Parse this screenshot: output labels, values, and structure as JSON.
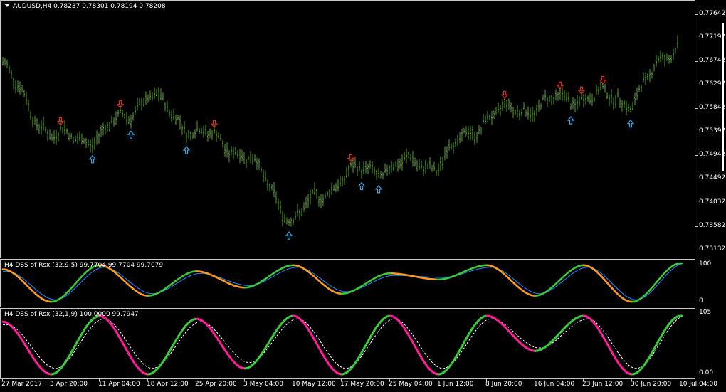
{
  "main_chart": {
    "title": "AUDUSD,H4  0.78237 0.78301 0.78194 0.78208",
    "price_labels": [
      "0.77642",
      "0.77192",
      "0.76742",
      "0.76292",
      "0.75842",
      "0.75392",
      "0.74942",
      "0.74492",
      "0.74032",
      "0.73582",
      "0.73132"
    ],
    "bar_color": "#5aa02c",
    "up_arrow_color": "#3aa6e0",
    "down_arrow_color": "#e0261e"
  },
  "indicator1": {
    "title": "H4 DSS of Rsx (32,9,5) 99.7704 99.7704 99.7079",
    "level_labels": [
      "100",
      "0"
    ],
    "colors": {
      "main": "#3cc83c",
      "falling": "#ff9a1e",
      "signal": "#1e90ff"
    }
  },
  "indicator2": {
    "title": "H4 DSS of Rsx (32,1,9) 100.0000 99.7947",
    "level_labels": [
      "105",
      "0.00"
    ],
    "colors": {
      "main": "#3cc83c",
      "falling": "#ff1e96",
      "signal": "#ffffff"
    }
  },
  "time_labels": [
    "27 Mar 2017",
    "3 Apr 20:00",
    "11 Apr 04:00",
    "18 Apr 12:00",
    "25 Apr 20:00",
    "3 May 04:00",
    "10 May 12:00",
    "17 May 20:00",
    "25 May 04:00",
    "1 Jun 12:00",
    "8 Jun 20:00",
    "16 Jun 04:00",
    "23 Jun 12:00",
    "30 Jun 20:00",
    "10 Jul 04:00"
  ],
  "chart_data": [
    {
      "type": "line",
      "title": "AUDUSD,H4",
      "xlabel": "",
      "ylabel": "",
      "ylim": [
        0.7297,
        0.7791
      ],
      "x": [
        "27 Mar 2017",
        "3 Apr 20:00",
        "11 Apr 04:00",
        "18 Apr 12:00",
        "25 Apr 20:00",
        "3 May 04:00",
        "10 May 12:00",
        "17 May 20:00",
        "25 May 04:00",
        "1 Jun 12:00",
        "8 Jun 20:00",
        "16 Jun 04:00",
        "23 Jun 12:00",
        "30 Jun 20:00",
        "10 Jul 04:00"
      ],
      "series": [
        {
          "name": "AUDUSD,H4",
          "values": [
            0.7665,
            0.753,
            0.753,
            0.761,
            0.754,
            0.75,
            0.737,
            0.7455,
            0.7475,
            0.748,
            0.757,
            0.759,
            0.761,
            0.76,
            0.772
          ]
        }
      ],
      "last_bar": {
        "open": 0.78237,
        "high": 0.78301,
        "low": 0.78194,
        "close": 0.78208
      }
    },
    {
      "type": "line",
      "title": "H4 DSS of Rsx (32,9,5)",
      "ylim": [
        0,
        100
      ],
      "x": [
        "27 Mar 2017",
        "3 Apr 20:00",
        "11 Apr 04:00",
        "18 Apr 12:00",
        "25 Apr 20:00",
        "3 May 04:00",
        "10 May 12:00",
        "17 May 20:00",
        "25 May 04:00",
        "1 Jun 12:00",
        "8 Jun 20:00",
        "16 Jun 04:00",
        "23 Jun 12:00",
        "30 Jun 20:00",
        "10 Jul 04:00"
      ],
      "series": [
        {
          "name": "",
          "values": [
            85,
            5,
            95,
            20,
            80,
            40,
            95,
            25,
            75,
            60,
            95,
            20,
            95,
            5,
            99.7704
          ]
        },
        {
          "name": "",
          "values": [
            80,
            10,
            90,
            25,
            75,
            45,
            90,
            30,
            70,
            65,
            90,
            25,
            90,
            10,
            99.7079
          ]
        }
      ],
      "last_values": [
        99.7704,
        99.7704,
        99.7079
      ]
    },
    {
      "type": "line",
      "title": "H4 DSS of Rsx (32,1,9)",
      "ylim": [
        0,
        105
      ],
      "x": [
        "27 Mar 2017",
        "3 Apr 20:00",
        "11 Apr 04:00",
        "18 Apr 12:00",
        "25 Apr 20:00",
        "3 May 04:00",
        "10 May 12:00",
        "17 May 20:00",
        "25 May 04:00",
        "1 Jun 12:00",
        "8 Jun 20:00",
        "16 Jun 04:00",
        "23 Jun 12:00",
        "30 Jun 20:00",
        "10 Jul 04:00"
      ],
      "series": [
        {
          "name": "",
          "values": [
            90,
            0,
            100,
            0,
            95,
            10,
            100,
            0,
            100,
            0,
            100,
            40,
            100,
            0,
            100.0
          ]
        },
        {
          "name": "",
          "values": [
            85,
            10,
            95,
            10,
            90,
            20,
            95,
            10,
            95,
            10,
            95,
            45,
            95,
            10,
            99.7947
          ]
        }
      ],
      "last_values": [
        100.0,
        99.7947
      ]
    }
  ]
}
